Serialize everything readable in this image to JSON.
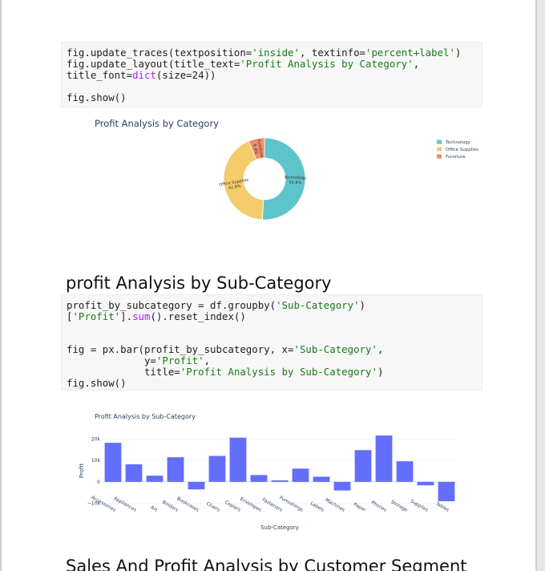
{
  "cell1": {
    "lines": [
      [
        {
          "t": "fig.update_traces(textposition="
        },
        {
          "t": "'inside'",
          "c": "str"
        },
        {
          "t": ", textinfo="
        },
        {
          "t": "'percent+label'",
          "c": "str"
        },
        {
          "t": ")"
        }
      ],
      [
        {
          "t": "fig.update_layout(title_text="
        },
        {
          "t": "'Profit Analysis by Category'",
          "c": "str"
        },
        {
          "t": ","
        }
      ],
      [
        {
          "t": "title_font="
        },
        {
          "t": "dict",
          "c": "fn"
        },
        {
          "t": "(size=24))"
        }
      ],
      [],
      [
        {
          "t": "fig.show()"
        }
      ]
    ]
  },
  "heading_subcategory": "profit Analysis by Sub-Category",
  "cell2": {
    "lines": [
      [
        {
          "t": "profit_by_subcategory = df.groupby("
        },
        {
          "t": "'Sub-Category'",
          "c": "str"
        },
        {
          "t": ")"
        }
      ],
      [
        {
          "t": "["
        },
        {
          "t": "'Profit'",
          "c": "str"
        },
        {
          "t": "]."
        },
        {
          "t": "sum",
          "c": "fn"
        },
        {
          "t": "().reset_index()"
        }
      ],
      [],
      [],
      [
        {
          "t": "fig = px.bar(profit_by_subcategory, x="
        },
        {
          "t": "'Sub-Category'",
          "c": "str"
        },
        {
          "t": ","
        }
      ],
      [
        {
          "t": "             y="
        },
        {
          "t": "'Profit'",
          "c": "str"
        },
        {
          "t": ","
        }
      ],
      [
        {
          "t": "             title="
        },
        {
          "t": "'Profit Analysis by Sub-Category'",
          "c": "str"
        },
        {
          "t": ")"
        }
      ],
      [
        {
          "t": "fig.show()"
        }
      ]
    ]
  },
  "heading_segment": "Sales And Profit Analysis by Customer Segment",
  "chart_data": [
    {
      "type": "pie",
      "hole": 0.5,
      "title": "Profit Analysis by Category",
      "labels": [
        "Technology",
        "Office Supplies",
        "Furniture"
      ],
      "values": [
        50.8,
        42.8,
        6.4
      ],
      "slice_text": [
        "Technology 50.8%",
        "Office Supplies 42.8%",
        "Furniture 6.4%"
      ],
      "colors": [
        "#5ec4cc",
        "#f4cc6c",
        "#ef8d6a"
      ],
      "legend": "top-right"
    },
    {
      "type": "bar",
      "title": "Profit Analysis by Sub-Category",
      "xlabel": "Sub-Category",
      "ylabel": "Profit",
      "categories": [
        "Accessories",
        "Appliances",
        "Art",
        "Binders",
        "Bookcases",
        "Chairs",
        "Copiers",
        "Envelopes",
        "Fasteners",
        "Furnishings",
        "Labels",
        "Machines",
        "Paper",
        "Phones",
        "Storage",
        "Supplies",
        "Tables"
      ],
      "values": [
        18200,
        8200,
        2900,
        11500,
        -3500,
        12100,
        20600,
        3200,
        700,
        6200,
        2400,
        -4000,
        14800,
        21600,
        9600,
        -1600,
        -9000
      ],
      "yticks": [
        -10000,
        0,
        10000,
        20000
      ],
      "ytick_labels": [
        "−10k",
        "0",
        "10k",
        "20k"
      ],
      "ylim": [
        -12000,
        22000
      ],
      "color": "#636efa",
      "grid": true
    }
  ]
}
